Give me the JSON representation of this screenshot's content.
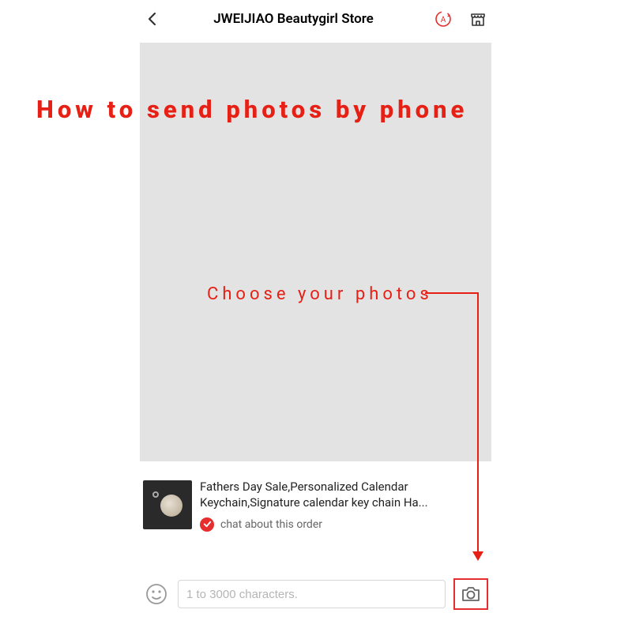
{
  "header": {
    "title": "JWEIJIAO Beautygirl Store"
  },
  "product": {
    "title": "Fathers Day Sale,Personalized Calendar Keychain,Signature calendar key chain Ha...",
    "chat_label": "chat about this order"
  },
  "input": {
    "placeholder": "1 to 3000 characters."
  },
  "overlay": {
    "title": "How to send photos by phone",
    "choose": "Choose your photos"
  }
}
